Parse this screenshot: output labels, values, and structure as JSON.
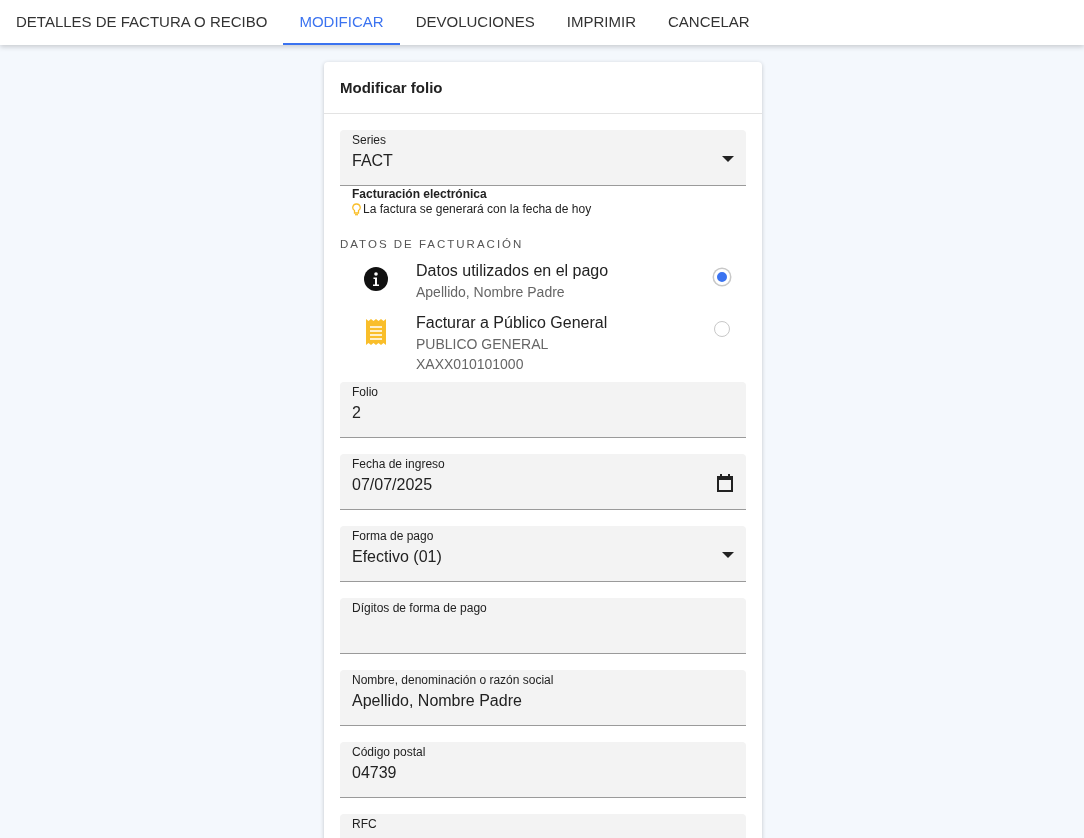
{
  "tabs": [
    {
      "label": "DETALLES DE FACTURA O RECIBO",
      "selected": false
    },
    {
      "label": "MODIFICAR",
      "selected": true
    },
    {
      "label": "DEVOLUCIONES",
      "selected": false
    },
    {
      "label": "IMPRIMIR",
      "selected": false
    },
    {
      "label": "CANCELAR",
      "selected": false
    }
  ],
  "card": {
    "title": "Modificar folio",
    "series_field": {
      "kind": "select",
      "label": "Series",
      "value": "FACT"
    },
    "note": {
      "title": "Facturación electrónica",
      "text": "La factura se generará con la fecha de hoy"
    },
    "section_heading": "DATOS DE FACTURACIÓN",
    "billing_options": [
      {
        "kind": "info",
        "title": "Datos utilizados en el pago",
        "lines": [
          "Apellido, Nombre Padre"
        ],
        "selected": true
      },
      {
        "kind": "receipt",
        "title": "Facturar a Público General",
        "lines": [
          "PUBLICO GENERAL",
          "XAXX010101000"
        ],
        "selected": false
      }
    ],
    "fields": [
      {
        "kind": "text",
        "label": "Folio",
        "value": "2"
      },
      {
        "kind": "date",
        "label": "Fecha de ingreso",
        "value": "07/07/2025"
      },
      {
        "kind": "select",
        "label": "Forma de pago",
        "value": "Efectivo (01)"
      },
      {
        "kind": "text",
        "label": "Dígitos de forma de pago"
      },
      {
        "kind": "text",
        "label": "Nombre, denominación o razón social",
        "value": "Apellido, Nombre Padre"
      },
      {
        "kind": "text",
        "label": "Código postal",
        "value": "04739"
      },
      {
        "kind": "text",
        "label": "RFC"
      }
    ]
  }
}
